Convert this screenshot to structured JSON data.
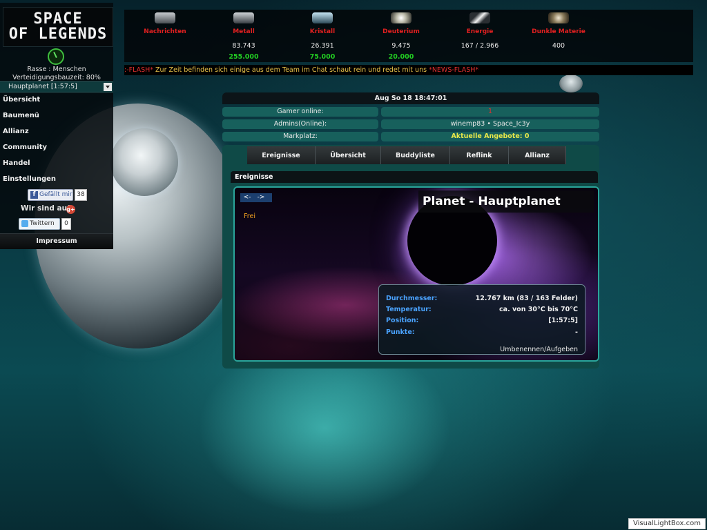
{
  "sidebar": {
    "logo_line1": "SPACE",
    "logo_line2": "OF LEGENDS",
    "race": "Rasse : Menschen",
    "defense": "Verteidigungsbauzeit: 80%",
    "planet_select": "Hauptplanet [1:57:5]",
    "nav": [
      "Übersicht",
      "Baumenü",
      "Allianz",
      "Community",
      "Handel",
      "Einstellungen"
    ],
    "fb_label": "Gefällt mir",
    "fb_count": "38",
    "gplus_text": "Wir sind auf",
    "twitter_label": "Twittern",
    "twitter_count": "0",
    "impressum": "Impressum"
  },
  "resources": [
    {
      "name": "Nachrichten",
      "amount": "",
      "cap": "",
      "icon": "message-icon",
      "color": "#8a8f96"
    },
    {
      "name": "Metall",
      "amount": "83.743",
      "cap": "255.000",
      "icon": "metal-icon",
      "color": "#9aa0a6"
    },
    {
      "name": "Kristall",
      "amount": "26.391",
      "cap": "75.000",
      "icon": "crystal-icon",
      "color": "#8fb6c9"
    },
    {
      "name": "Deuterium",
      "amount": "9.475",
      "cap": "20.000",
      "icon": "deuterium-icon",
      "color": "#e6e6d8"
    },
    {
      "name": "Energie",
      "amount": "167 / 2.966",
      "cap": "",
      "icon": "energy-icon",
      "color": "#c8c8c8"
    },
    {
      "name": "Dunkle Materie",
      "amount": "400",
      "cap": "",
      "icon": "dark-matter-icon",
      "color": "#b6a58a"
    }
  ],
  "ticker": {
    "prefix": ":-FLASH*",
    "message": " Zur Zeit befinden sich einige aus dem Team im Chat schaut rein und redet mit uns ",
    "suffix": "*NEWS-FLASH*"
  },
  "main": {
    "datetime": "Aug So 18 18:47:01",
    "info": [
      {
        "label": "Gamer online:",
        "value": "1",
        "value_color": "#e03030"
      },
      {
        "label": "Admins(Online):",
        "value": "winemp83 • Space_Ic3y",
        "value_color": "#e8e8e8"
      },
      {
        "label": "Markplatz:",
        "value": "Aktuelle Angebote: 0",
        "value_color": "#e8e84a"
      }
    ],
    "tabs": [
      "Ereignisse",
      "Übersicht",
      "Buddyliste",
      "Reflink",
      "Allianz"
    ],
    "events_header": "Ereignisse",
    "arrow_prev": "<-",
    "arrow_next": "->",
    "status": "Frei",
    "planet_title": "Planet - Hauptplanet",
    "planet_info": [
      {
        "label": "Durchmesser:",
        "value": "12.767 km (83 / 163 Felder)"
      },
      {
        "label": "Temperatur:",
        "value": "ca. von 30°C bis 70°C"
      },
      {
        "label": "Position:",
        "value": "[1:57:5]"
      },
      {
        "label": "Punkte:",
        "value": "-"
      }
    ],
    "rename_link": "Umbenennen/Aufgeben"
  },
  "watermark": "VisualLightBox.com"
}
